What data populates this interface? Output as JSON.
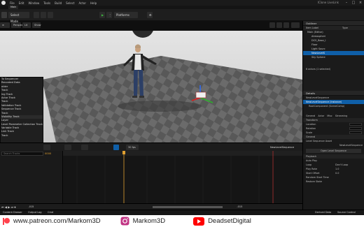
{
  "menubar": {
    "items": [
      "File",
      "Edit",
      "Window",
      "Tools",
      "Build",
      "Select",
      "Actor",
      "Help"
    ],
    "project": "IClone LiveLink"
  },
  "tabs": [
    {
      "label": "Main"
    }
  ],
  "toolbar": {
    "mode": "Select Mode",
    "platforms": "Platforms"
  },
  "viewport": {
    "perspective": "Perspective",
    "lit": "Lit",
    "show": "Show"
  },
  "add_track_menu": {
    "items": [
      "To Sequencer",
      "Recorded Data",
      "older",
      "Track",
      "ing Track",
      "Actor Track",
      "Track",
      "Validation Track",
      "Sequence Track",
      "Track",
      "Visibility Track",
      "Layer",
      "Level Parameter Collection Track",
      "Variable Track",
      "Link Track",
      "Track"
    ]
  },
  "sequencer": {
    "search_placeholder": "Search Tracks",
    "fps": "30 fps",
    "current_frame": "0000",
    "sequence_name": "NewLevelSequence",
    "timecode_left": "-015",
    "timecode_right": "-015",
    "end_mark": "0150"
  },
  "outliner": {
    "title": "Outliner",
    "header_label": "Item Label",
    "header_type": "Type",
    "rows": [
      {
        "label": "Main (Editor)",
        "type": "",
        "selected": false
      },
      {
        "label": "Atmospheri",
        "type": "",
        "selected": false
      },
      {
        "label": "DCS_Base_I",
        "type": "",
        "selected": false
      },
      {
        "label": "Floor",
        "type": "",
        "selected": false
      },
      {
        "label": "Light Sourc",
        "type": "",
        "selected": false
      },
      {
        "label": "NewLevelS",
        "type": "",
        "selected": true
      },
      {
        "label": "Sky Sphere",
        "type": "",
        "selected": false
      }
    ],
    "count": "6 actors (1 selected)"
  },
  "details": {
    "title": "Details",
    "object": "NewLevelSequence",
    "component": "NewLevelSequence (Instance)",
    "root": "RootComponent (SceneComp)",
    "tabs": [
      "General",
      "Actor",
      "Misc",
      "Streaming"
    ],
    "transform_label": "Transform",
    "location_label": "Location",
    "rotation_label": "Rotation",
    "scale_label": "Scale",
    "general_label": "General",
    "asset_label": "Level Sequence Asset",
    "asset_value": "NewLevelSequence",
    "open_button": "Open Level Sequence",
    "playback_label": "Playback",
    "auto_play": "Auto Play",
    "loop": "Loop",
    "loop_value": "Don't Loop",
    "play_rate": "Play Rate",
    "play_rate_value": "1.0",
    "start_offset": "Start Offset",
    "start_offset_value": "0.0",
    "random_start": "Random Start Time",
    "restore_state": "Restore State"
  },
  "statusbar": {
    "content_drawer": "Content Drawer",
    "output_log": "Output Log",
    "cmd": "Cmd",
    "derived_data": "Derived Data",
    "source_control": "Source Control"
  },
  "banner": {
    "site": "www.patreon.com/Markom3D",
    "instagram": "Markom3D",
    "youtube": "DeadsetDigital",
    "colors": {
      "patreon": "#ff424d",
      "instagram": "#c13584",
      "youtube": "#ff0000"
    }
  }
}
